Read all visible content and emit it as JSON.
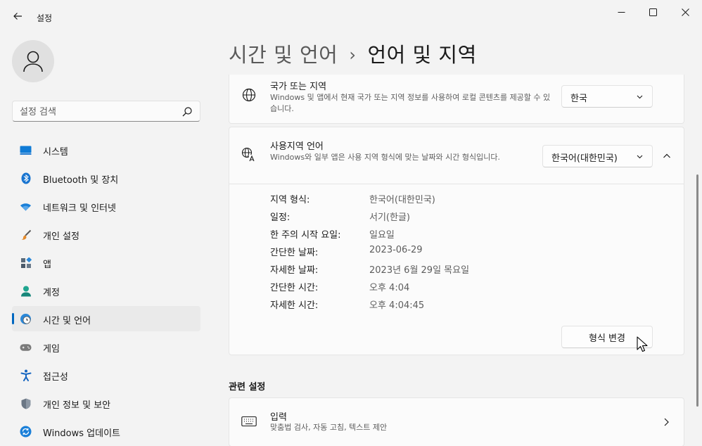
{
  "window": {
    "title": "설정"
  },
  "search": {
    "placeholder": "설정 검색"
  },
  "sidebar": {
    "items": [
      {
        "label": "시스템",
        "icon": "system-icon"
      },
      {
        "label": "Bluetooth 및 장치",
        "icon": "bluetooth-icon"
      },
      {
        "label": "네트워크 및 인터넷",
        "icon": "wifi-icon"
      },
      {
        "label": "개인 설정",
        "icon": "brush-icon"
      },
      {
        "label": "앱",
        "icon": "apps-icon"
      },
      {
        "label": "계정",
        "icon": "account-icon"
      },
      {
        "label": "시간 및 언어",
        "icon": "time-language-icon",
        "active": true
      },
      {
        "label": "게임",
        "icon": "gamepad-icon"
      },
      {
        "label": "접근성",
        "icon": "accessibility-icon"
      },
      {
        "label": "개인 정보 및 보안",
        "icon": "shield-icon"
      },
      {
        "label": "Windows 업데이트",
        "icon": "update-icon"
      }
    ]
  },
  "header": {
    "parent": "시간 및 언어",
    "separator": "›",
    "current": "언어 및 지역"
  },
  "region_card": {
    "title": "국가 또는 지역",
    "description": "Windows 및 앱에서 현재 국가 또는 지역 정보를 사용하여 로컬 콘텐츠를 제공할 수 있습니다.",
    "dropdown_value": "한국",
    "icon": "globe-icon"
  },
  "format_card": {
    "title": "사용지역 언어",
    "description": "Windows와 일부 앱은 사용 지역 형식에 맞는 날짜와 시간 형식입니다.",
    "dropdown_value": "한국어(대한민국)",
    "icon": "language-format-icon",
    "rows": [
      {
        "key": "지역 형식:",
        "value": "한국어(대한민국)"
      },
      {
        "key": "일정:",
        "value": "서기(한글)"
      },
      {
        "key": "한 주의 시작 요일:",
        "value": "일요일"
      },
      {
        "key": "간단한 날짜:",
        "value": "2023-06-29"
      },
      {
        "key": "자세한 날짜:",
        "value": "2023년 6월 29일 목요일"
      },
      {
        "key": "간단한 시간:",
        "value": "오후 4:04"
      },
      {
        "key": "자세한 시간:",
        "value": "오후 4:04:45"
      }
    ],
    "change_button": "형식 변경"
  },
  "related": {
    "heading": "관련 설정",
    "input_card": {
      "title": "입력",
      "description": "맞춤법 검사, 자동 고침, 텍스트 제안",
      "icon": "keyboard-icon"
    }
  },
  "colors": {
    "accent": "#0067c0",
    "background": "#f3f3f3",
    "card": "#fbfbfb"
  }
}
